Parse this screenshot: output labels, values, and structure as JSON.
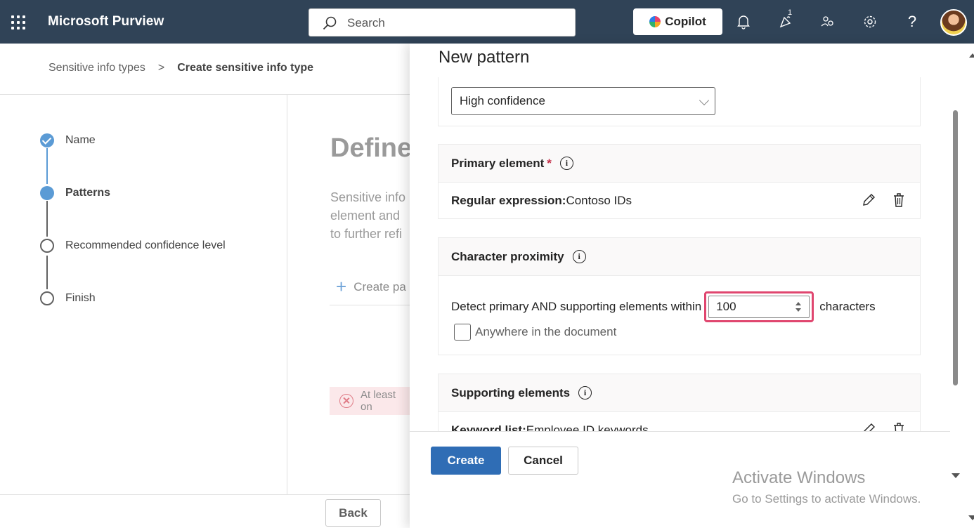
{
  "header": {
    "app_title": "Microsoft Purview",
    "search_placeholder": "Search",
    "copilot_label": "Copilot",
    "notification_badge": "1"
  },
  "breadcrumb": {
    "parent": "Sensitive info types",
    "separator": ">",
    "current": "Create sensitive info type"
  },
  "wizard": {
    "steps": [
      {
        "label": "Name",
        "state": "done"
      },
      {
        "label": "Patterns",
        "state": "current"
      },
      {
        "label": "Recommended confidence level",
        "state": "pending"
      },
      {
        "label": "Finish",
        "state": "pending"
      }
    ],
    "title": "Define",
    "description_lines": [
      "Sensitive info",
      "element and",
      "to further refi"
    ],
    "create_pattern_label": "Create pa",
    "error_text": "At least on",
    "back_label": "Back"
  },
  "panel": {
    "title": "New pattern",
    "confidence_value": "High confidence",
    "primary_element": {
      "heading": "Primary element",
      "required_mark": "*",
      "key": "Regular expression:",
      "value": "Contoso IDs"
    },
    "character_proximity": {
      "heading": "Character proximity",
      "prefix": "Detect primary AND supporting elements within",
      "value": "100",
      "suffix": "characters",
      "anywhere_label": "Anywhere in the document"
    },
    "supporting_elements": {
      "heading": "Supporting elements",
      "key": "Keyword list:",
      "value": "Employee ID keywords"
    },
    "create_label": "Create",
    "cancel_label": "Cancel"
  },
  "watermark": {
    "line1": "Activate Windows",
    "line2": "Go to Settings to activate Windows."
  },
  "colors": {
    "topbar": "#304357",
    "primary_button": "#2f6db5",
    "highlight": "#e0466f",
    "step_active": "#5b9bd5"
  }
}
